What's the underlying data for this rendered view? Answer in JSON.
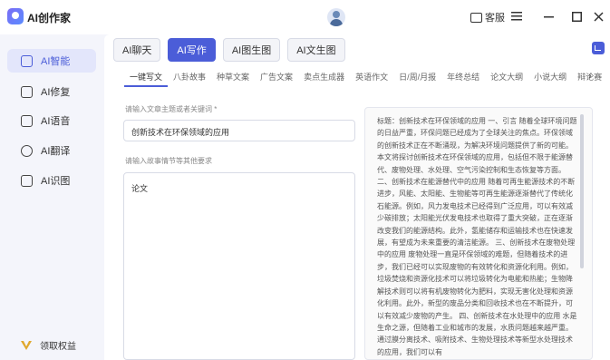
{
  "app": {
    "title": "AI创作家"
  },
  "titlebar": {
    "service_label": "客服",
    "menu_icon": "hamburger-icon",
    "minimize_icon": "minimize-icon",
    "maximize_icon": "maximize-icon",
    "close_icon": "close-icon"
  },
  "sidebar": {
    "items": [
      {
        "label": "AI智能",
        "icon": "robot-icon",
        "active": true
      },
      {
        "label": "AI修复",
        "icon": "image-repair-icon",
        "active": false
      },
      {
        "label": "AI语音",
        "icon": "voice-icon",
        "active": false
      },
      {
        "label": "AI翻译",
        "icon": "translate-icon",
        "active": false
      },
      {
        "label": "AI识图",
        "icon": "image-recognition-icon",
        "active": false
      }
    ],
    "bottom": {
      "label": "领取权益",
      "icon": "vip-icon"
    }
  },
  "toptabs": [
    {
      "label": "AI聊天",
      "active": false
    },
    {
      "label": "AI写作",
      "active": true
    },
    {
      "label": "AI图生图",
      "active": false
    },
    {
      "label": "AI文生图",
      "active": false
    }
  ],
  "subtabs": [
    "一键写文",
    "八卦故事",
    "种草文案",
    "广告文案",
    "卖点生成器",
    "英语作文",
    "日/周/月报",
    "年终总结",
    "论文大纲",
    "小说大纲",
    "辩论赛"
  ],
  "subtabs_more": "›",
  "form": {
    "keyword_label": "请输入文章主题或者关键词 *",
    "keyword_value": "创新技术在环保领域的应用",
    "detail_label": "请输入故事情节等其他要求",
    "detail_value": "论文"
  },
  "output": {
    "text": "标题：创新技术在环保领域的应用 一、引言 随着全球环境问题的日益严重，环保问题已经成为了全球关注的焦点。环保领域的创新技术正在不断涌现，为解决环境问题提供了新的可能。本文将探讨创新技术在环保领域的应用，包括但不限于能源替代、废物处理、水处理、空气污染控制和生态恢复等方面。 二、创新技术在能源替代中的应用 随着可再生能源技术的不断进步，风能、太阳能、生物能等可再生能源逐渐替代了传统化石能源。例如，风力发电技术已经得到广泛应用，可以有效减少碳排放；太阳能光伏发电技术也取得了重大突破，正在逐渐改变我们的能源结构。此外，氢能储存和运输技术也在快速发展，有望成为未来重要的清洁能源。 三、创新技术在废物处理中的应用 废物处理一直是环保领域的难题，但随着技术的进步，我们已经可以实现废物的有效转化和资源化利用。例如，垃圾焚烧和资源化技术可以将垃圾转化为电能和热能；生物降解技术则可以将有机废物转化为肥料，实现无害化处理和资源化利用。此外，新型的废品分类和回收技术也在不断提升，可以有效减少废物的产生。 四、创新技术在水处理中的应用 水是生命之源，但随着工业和城市的发展，水质问题越来越严重。通过膜分离技术、吸附技术、生物处理技术等新型水处理技术的应用，我们可以有"
  }
}
